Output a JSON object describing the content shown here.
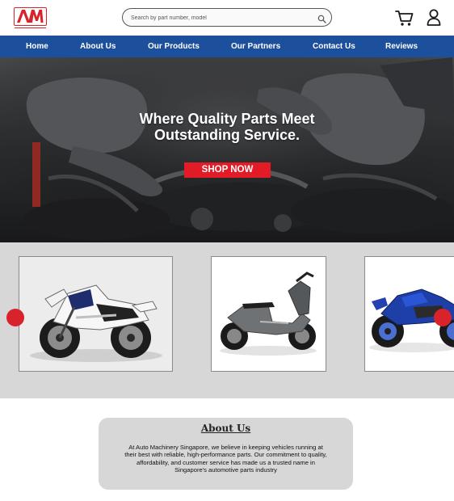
{
  "brand": {
    "logo_text": "AM",
    "tagline": "Auto Machinery Singapore"
  },
  "search": {
    "placeholder": "Search by part number, model"
  },
  "nav": {
    "items": [
      {
        "label": "Home"
      },
      {
        "label": "About Us"
      },
      {
        "label": "Our Products"
      },
      {
        "label": "Our Partners"
      },
      {
        "label": "Contact Us"
      },
      {
        "label": "Reviews"
      }
    ]
  },
  "hero": {
    "title_line1": "Where Quality Parts Meet",
    "title_line2": "Outstanding Service.",
    "cta_label": "SHOP NOW"
  },
  "about": {
    "title": "About Us",
    "body": "At Auto Machinery Singapore, we believe in keeping vehicles running at their best with reliable, high-performance parts. Our commitment to quality, affordability, and customer service has made us a trusted name in Singapore's automotive parts industry"
  },
  "colors": {
    "brand_red": "#d8232a",
    "nav_blue": "#1c4f9c",
    "panel_gray": "#d7d7d7",
    "cta_red": "#e21b26"
  },
  "icons": [
    "search-icon",
    "cart-icon",
    "user-icon",
    "carousel-prev-icon",
    "carousel-next-icon"
  ]
}
